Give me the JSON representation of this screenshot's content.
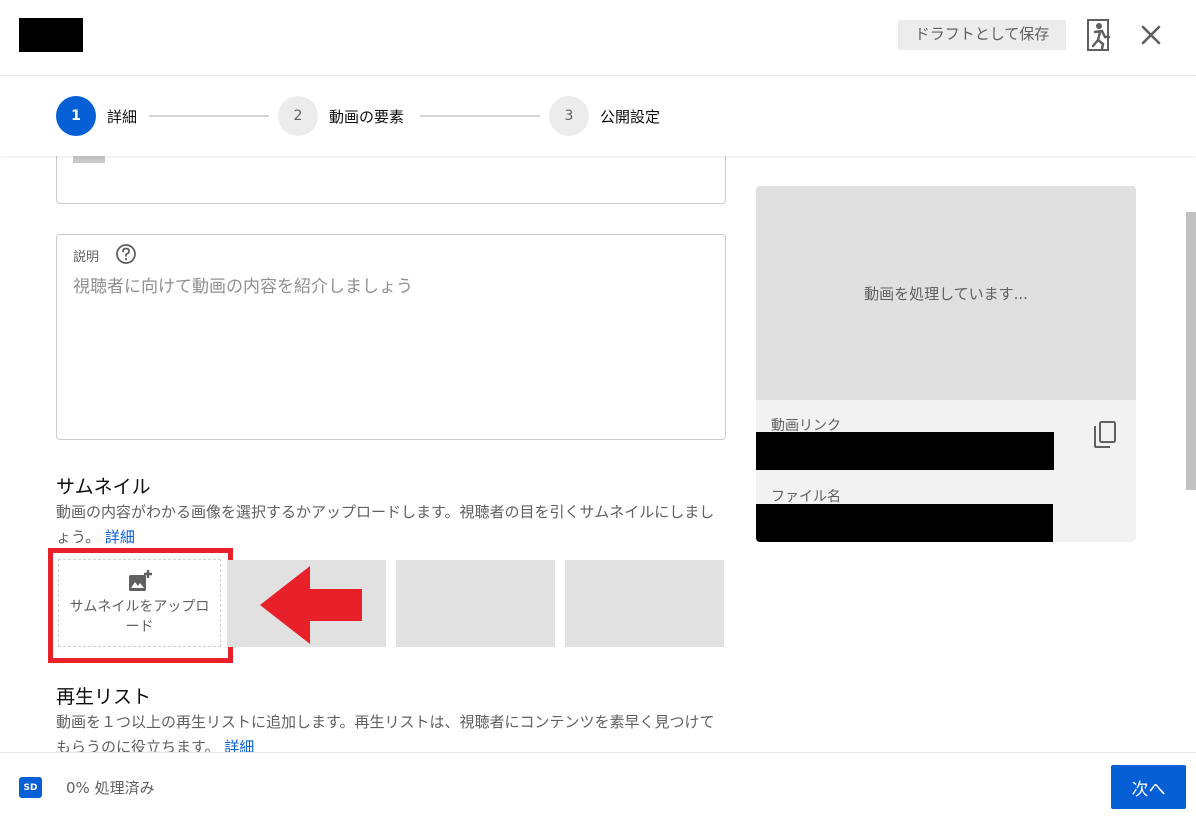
{
  "header": {
    "draft_label": "ドラフトとして保存",
    "exit_icon": "exit-person-icon",
    "close_icon": "close-icon"
  },
  "stepper": {
    "steps": [
      {
        "number": "1",
        "label": "詳細",
        "active": true
      },
      {
        "number": "2",
        "label": "動画の要素",
        "active": false
      },
      {
        "number": "3",
        "label": "公開設定",
        "active": false
      }
    ]
  },
  "description": {
    "label": "説明",
    "placeholder": "視聴者に向けて動画の内容を紹介しましょう"
  },
  "thumbnail": {
    "title": "サムネイル",
    "text": "動画の内容がわかる画像を選択するかアップロードします。視聴者の目を引くサムネイルにしましょう。",
    "link": "詳細",
    "upload_label": "サムネイルをアップロード"
  },
  "playlist": {
    "title": "再生リスト",
    "text": "動画を１つ以上の再生リストに追加します。再生リストは、視聴者にコンテンツを素早く見つけてもらうのに役立ちます。",
    "link": "詳細"
  },
  "preview": {
    "processing_text": "動画を処理しています...",
    "link_label": "動画リンク",
    "file_label": "ファイル名"
  },
  "footer": {
    "badge": "SD",
    "progress_text": "0% 処理済み",
    "next_label": "次へ"
  },
  "colors": {
    "accent": "#065fd4",
    "highlight": "#e8202a"
  }
}
